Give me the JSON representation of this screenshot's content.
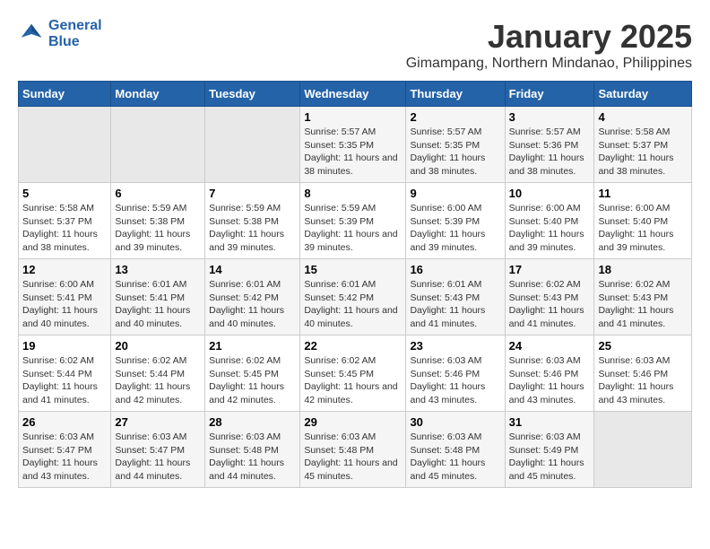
{
  "logo": {
    "line1": "General",
    "line2": "Blue"
  },
  "title": "January 2025",
  "location": "Gimampang, Northern Mindanao, Philippines",
  "days_header": [
    "Sunday",
    "Monday",
    "Tuesday",
    "Wednesday",
    "Thursday",
    "Friday",
    "Saturday"
  ],
  "weeks": [
    [
      {
        "day": "",
        "sunrise": "",
        "sunset": "",
        "daylight": ""
      },
      {
        "day": "",
        "sunrise": "",
        "sunset": "",
        "daylight": ""
      },
      {
        "day": "",
        "sunrise": "",
        "sunset": "",
        "daylight": ""
      },
      {
        "day": "1",
        "sunrise": "Sunrise: 5:57 AM",
        "sunset": "Sunset: 5:35 PM",
        "daylight": "Daylight: 11 hours and 38 minutes."
      },
      {
        "day": "2",
        "sunrise": "Sunrise: 5:57 AM",
        "sunset": "Sunset: 5:35 PM",
        "daylight": "Daylight: 11 hours and 38 minutes."
      },
      {
        "day": "3",
        "sunrise": "Sunrise: 5:57 AM",
        "sunset": "Sunset: 5:36 PM",
        "daylight": "Daylight: 11 hours and 38 minutes."
      },
      {
        "day": "4",
        "sunrise": "Sunrise: 5:58 AM",
        "sunset": "Sunset: 5:37 PM",
        "daylight": "Daylight: 11 hours and 38 minutes."
      }
    ],
    [
      {
        "day": "5",
        "sunrise": "Sunrise: 5:58 AM",
        "sunset": "Sunset: 5:37 PM",
        "daylight": "Daylight: 11 hours and 38 minutes."
      },
      {
        "day": "6",
        "sunrise": "Sunrise: 5:59 AM",
        "sunset": "Sunset: 5:38 PM",
        "daylight": "Daylight: 11 hours and 39 minutes."
      },
      {
        "day": "7",
        "sunrise": "Sunrise: 5:59 AM",
        "sunset": "Sunset: 5:38 PM",
        "daylight": "Daylight: 11 hours and 39 minutes."
      },
      {
        "day": "8",
        "sunrise": "Sunrise: 5:59 AM",
        "sunset": "Sunset: 5:39 PM",
        "daylight": "Daylight: 11 hours and 39 minutes."
      },
      {
        "day": "9",
        "sunrise": "Sunrise: 6:00 AM",
        "sunset": "Sunset: 5:39 PM",
        "daylight": "Daylight: 11 hours and 39 minutes."
      },
      {
        "day": "10",
        "sunrise": "Sunrise: 6:00 AM",
        "sunset": "Sunset: 5:40 PM",
        "daylight": "Daylight: 11 hours and 39 minutes."
      },
      {
        "day": "11",
        "sunrise": "Sunrise: 6:00 AM",
        "sunset": "Sunset: 5:40 PM",
        "daylight": "Daylight: 11 hours and 39 minutes."
      }
    ],
    [
      {
        "day": "12",
        "sunrise": "Sunrise: 6:00 AM",
        "sunset": "Sunset: 5:41 PM",
        "daylight": "Daylight: 11 hours and 40 minutes."
      },
      {
        "day": "13",
        "sunrise": "Sunrise: 6:01 AM",
        "sunset": "Sunset: 5:41 PM",
        "daylight": "Daylight: 11 hours and 40 minutes."
      },
      {
        "day": "14",
        "sunrise": "Sunrise: 6:01 AM",
        "sunset": "Sunset: 5:42 PM",
        "daylight": "Daylight: 11 hours and 40 minutes."
      },
      {
        "day": "15",
        "sunrise": "Sunrise: 6:01 AM",
        "sunset": "Sunset: 5:42 PM",
        "daylight": "Daylight: 11 hours and 40 minutes."
      },
      {
        "day": "16",
        "sunrise": "Sunrise: 6:01 AM",
        "sunset": "Sunset: 5:43 PM",
        "daylight": "Daylight: 11 hours and 41 minutes."
      },
      {
        "day": "17",
        "sunrise": "Sunrise: 6:02 AM",
        "sunset": "Sunset: 5:43 PM",
        "daylight": "Daylight: 11 hours and 41 minutes."
      },
      {
        "day": "18",
        "sunrise": "Sunrise: 6:02 AM",
        "sunset": "Sunset: 5:43 PM",
        "daylight": "Daylight: 11 hours and 41 minutes."
      }
    ],
    [
      {
        "day": "19",
        "sunrise": "Sunrise: 6:02 AM",
        "sunset": "Sunset: 5:44 PM",
        "daylight": "Daylight: 11 hours and 41 minutes."
      },
      {
        "day": "20",
        "sunrise": "Sunrise: 6:02 AM",
        "sunset": "Sunset: 5:44 PM",
        "daylight": "Daylight: 11 hours and 42 minutes."
      },
      {
        "day": "21",
        "sunrise": "Sunrise: 6:02 AM",
        "sunset": "Sunset: 5:45 PM",
        "daylight": "Daylight: 11 hours and 42 minutes."
      },
      {
        "day": "22",
        "sunrise": "Sunrise: 6:02 AM",
        "sunset": "Sunset: 5:45 PM",
        "daylight": "Daylight: 11 hours and 42 minutes."
      },
      {
        "day": "23",
        "sunrise": "Sunrise: 6:03 AM",
        "sunset": "Sunset: 5:46 PM",
        "daylight": "Daylight: 11 hours and 43 minutes."
      },
      {
        "day": "24",
        "sunrise": "Sunrise: 6:03 AM",
        "sunset": "Sunset: 5:46 PM",
        "daylight": "Daylight: 11 hours and 43 minutes."
      },
      {
        "day": "25",
        "sunrise": "Sunrise: 6:03 AM",
        "sunset": "Sunset: 5:46 PM",
        "daylight": "Daylight: 11 hours and 43 minutes."
      }
    ],
    [
      {
        "day": "26",
        "sunrise": "Sunrise: 6:03 AM",
        "sunset": "Sunset: 5:47 PM",
        "daylight": "Daylight: 11 hours and 43 minutes."
      },
      {
        "day": "27",
        "sunrise": "Sunrise: 6:03 AM",
        "sunset": "Sunset: 5:47 PM",
        "daylight": "Daylight: 11 hours and 44 minutes."
      },
      {
        "day": "28",
        "sunrise": "Sunrise: 6:03 AM",
        "sunset": "Sunset: 5:48 PM",
        "daylight": "Daylight: 11 hours and 44 minutes."
      },
      {
        "day": "29",
        "sunrise": "Sunrise: 6:03 AM",
        "sunset": "Sunset: 5:48 PM",
        "daylight": "Daylight: 11 hours and 45 minutes."
      },
      {
        "day": "30",
        "sunrise": "Sunrise: 6:03 AM",
        "sunset": "Sunset: 5:48 PM",
        "daylight": "Daylight: 11 hours and 45 minutes."
      },
      {
        "day": "31",
        "sunrise": "Sunrise: 6:03 AM",
        "sunset": "Sunset: 5:49 PM",
        "daylight": "Daylight: 11 hours and 45 minutes."
      },
      {
        "day": "",
        "sunrise": "",
        "sunset": "",
        "daylight": ""
      }
    ]
  ]
}
